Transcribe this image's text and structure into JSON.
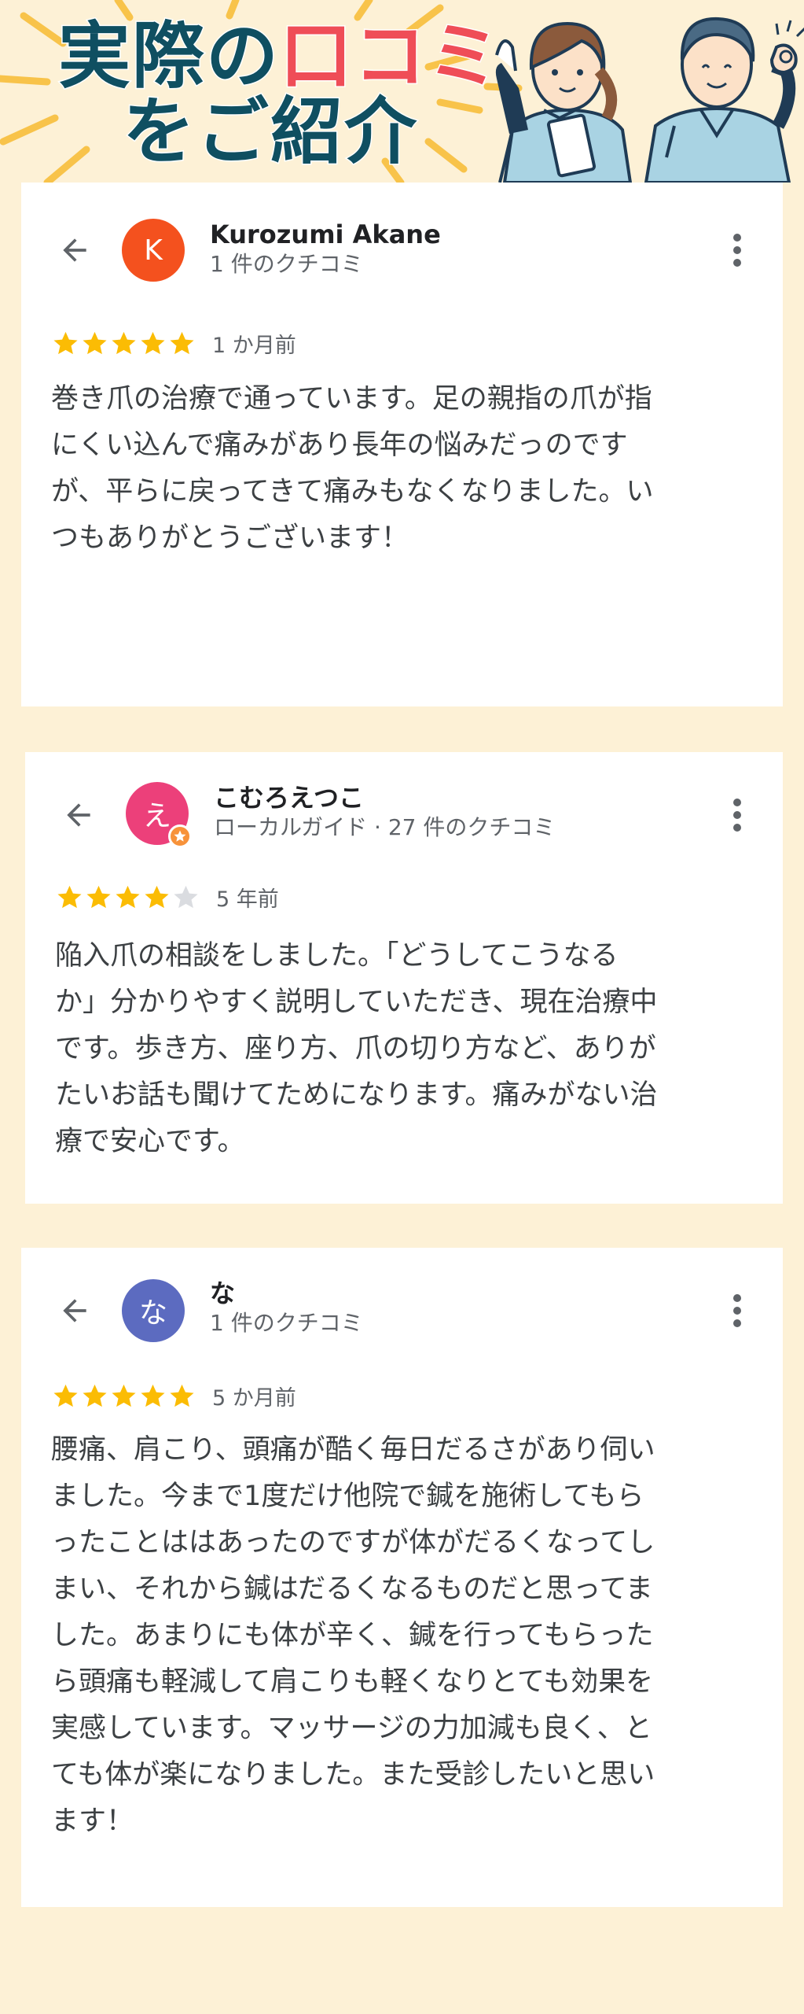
{
  "header": {
    "title_line1_part1": "実際の",
    "title_line1_accent": "口コミ",
    "title_line2": "をご紹介"
  },
  "reviews": [
    {
      "avatar_letter": "K",
      "avatar_color": "#f4511e",
      "has_local_guide_badge": false,
      "name": "Kurozumi Akane",
      "meta": "1 件のクチコミ",
      "rating": 5,
      "date": "1 か月前",
      "text": "巻き爪の治療で通っています。足の親指の爪が指\nにくい込んで痛みがあり長年の悩みだっのです\nが、平らに戻ってきて痛みもなくなりました。い\nつもありがとうございます！"
    },
    {
      "avatar_letter": "え",
      "avatar_color": "#ec407a",
      "has_local_guide_badge": true,
      "name": "こむろえつこ",
      "meta": "ローカルガイド · 27 件のクチコミ",
      "rating": 4,
      "date": "5 年前",
      "text": "陥入爪の相談をしました。「どうしてこうなる\nか」分かりやすく説明していただき、現在治療中\nです。歩き方、座り方、爪の切り方など、ありが\nたいお話も聞けてためになります。痛みがない治\n療で安心です。"
    },
    {
      "avatar_letter": "な",
      "avatar_color": "#5c6bc0",
      "has_local_guide_badge": false,
      "name": "な",
      "meta": "1 件のクチコミ",
      "rating": 5,
      "date": "5 か月前",
      "text": "腰痛、肩こり、頭痛が酷く毎日だるさがあり伺い\nました。今まで1度だけ他院で鍼を施術してもら\nったことははあったのですが体がだるくなってし\nまい、それから鍼はだるくなるものだと思ってま\nした。あまりにも体が辛く、鍼を行ってもらった\nら頭痛も軽減して肩こりも軽くなりとても効果を\n実感しています。マッサージの力加減も良く、と\nても体が楽になりました。また受診したいと思い\nます！"
    }
  ],
  "colors": {
    "background": "#fdf1d6",
    "title_navy": "#0f4f61",
    "title_accent": "#ef4d57",
    "star_filled": "#fbbc04",
    "star_empty": "#dadce0",
    "icon_gray": "#5f6368"
  },
  "icons": {
    "back": "arrow-back-icon",
    "more": "more-vert-icon",
    "star": "star-icon",
    "badge": "local-guide-badge-icon"
  }
}
